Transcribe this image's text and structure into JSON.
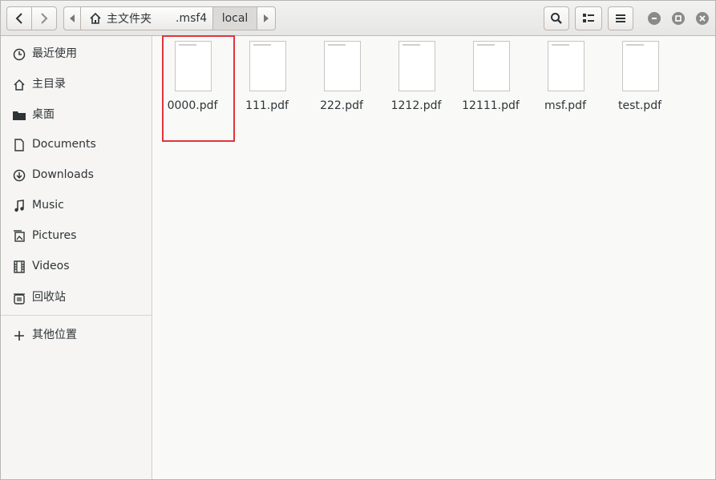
{
  "header": {
    "path": {
      "home_label": "主文件夹",
      "sub_label": ".msf4",
      "current_label": "local"
    }
  },
  "sidebar": {
    "items": [
      {
        "label": "最近使用",
        "icon": "clock-icon"
      },
      {
        "label": "主目录",
        "icon": "home-icon"
      },
      {
        "label": "桌面",
        "icon": "folder-icon"
      },
      {
        "label": "Documents",
        "icon": "document-icon"
      },
      {
        "label": "Downloads",
        "icon": "download-icon"
      },
      {
        "label": "Music",
        "icon": "music-icon"
      },
      {
        "label": "Pictures",
        "icon": "pictures-icon"
      },
      {
        "label": "Videos",
        "icon": "video-icon"
      },
      {
        "label": "回收站",
        "icon": "trash-icon"
      },
      {
        "label": "其他位置",
        "icon": "plus-icon"
      }
    ]
  },
  "files": [
    {
      "name": "0000.pdf",
      "highlighted": true
    },
    {
      "name": "111.pdf"
    },
    {
      "name": "222.pdf"
    },
    {
      "name": "1212.pdf"
    },
    {
      "name": "12111.pdf"
    },
    {
      "name": "msf.pdf"
    },
    {
      "name": "test.pdf"
    }
  ],
  "colors": {
    "highlight": "#e0353b"
  }
}
